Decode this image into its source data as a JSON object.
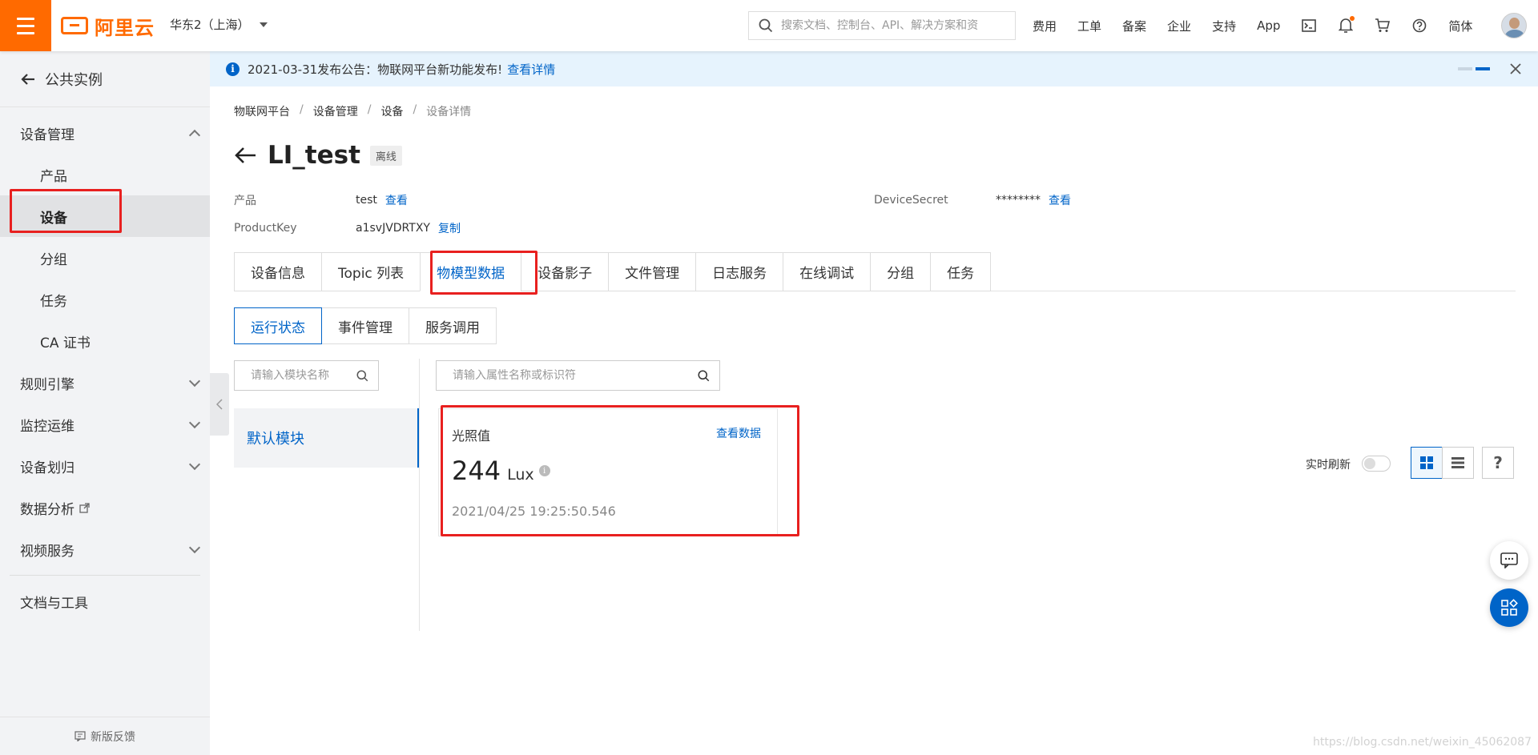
{
  "topbar": {
    "logo_text": "阿里云",
    "region": "华东2（上海）",
    "search_placeholder": "搜索文档、控制台、API、解决方案和资",
    "nav": [
      "费用",
      "工单",
      "备案",
      "企业",
      "支持",
      "App"
    ],
    "lang": "简体"
  },
  "sidebar": {
    "back_label": "公共实例",
    "group": "设备管理",
    "items": [
      "产品",
      "设备",
      "分组",
      "任务",
      "CA 证书"
    ],
    "sections": [
      "规则引擎",
      "监控运维",
      "设备划归",
      "数据分析",
      "视频服务"
    ],
    "docs": "文档与工具",
    "feedback": "新版反馈"
  },
  "notice": {
    "text": "2021-03-31发布公告：物联网平台新功能发布!",
    "link": "查看详情"
  },
  "breadcrumb": [
    "物联网平台",
    "设备管理",
    "设备",
    "设备详情"
  ],
  "device": {
    "name": "LI_test",
    "status": "离线",
    "product_label": "产品",
    "product_value": "test",
    "product_link": "查看",
    "productkey_label": "ProductKey",
    "productkey_value": "a1svJVDRTXY",
    "productkey_link": "复制",
    "secret_label": "DeviceSecret",
    "secret_value": "********",
    "secret_link": "查看"
  },
  "tabs": [
    "设备信息",
    "Topic 列表",
    "物模型数据",
    "设备影子",
    "文件管理",
    "日志服务",
    "在线调试",
    "分组",
    "任务"
  ],
  "subtabs": [
    "运行状态",
    "事件管理",
    "服务调用"
  ],
  "module_search_placeholder": "请输入模块名称",
  "prop_search_placeholder": "请输入属性名称或标识符",
  "module_default": "默认模块",
  "realtime_label": "实时刷新",
  "card": {
    "name": "光照值",
    "link": "查看数据",
    "value": "244",
    "unit": "Lux",
    "time": "2021/04/25 19:25:50.546"
  },
  "watermark": "https://blog.csdn.net/weixin_45062087",
  "colors": {
    "brand": "#ff6a00",
    "accent": "#0064c8",
    "highlight": "#e8201f"
  }
}
